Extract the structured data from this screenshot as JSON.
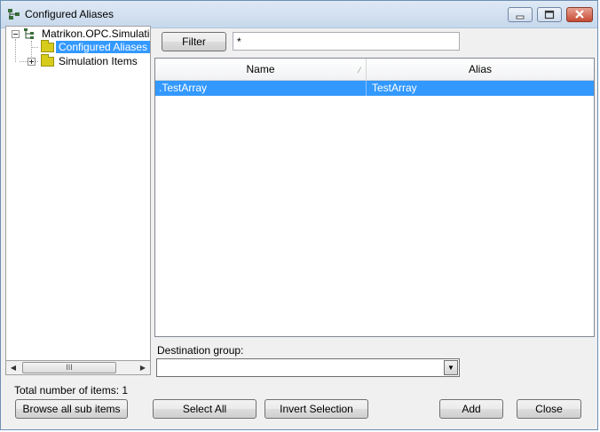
{
  "window": {
    "title": "Configured Aliases",
    "icon": "tree-network-icon",
    "controls": [
      "minimize",
      "maximize",
      "close"
    ]
  },
  "tree": {
    "root": {
      "label": "Matrikon.OPC.Simulatio",
      "expanded": true
    },
    "children": [
      {
        "label": "Configured Aliases",
        "selected": true
      },
      {
        "label": "Simulation Items",
        "expanded": false
      }
    ],
    "scroll_grip": "III"
  },
  "filter": {
    "button_label": "Filter",
    "value": "*"
  },
  "table": {
    "columns": [
      "Name",
      "Alias"
    ],
    "sort_indicator": "⁄",
    "rows": [
      {
        "name": ".TestArray",
        "alias": "TestArray",
        "selected": true
      }
    ]
  },
  "destination": {
    "label": "Destination group:",
    "value": ""
  },
  "status": {
    "total_text": "Total number of items: 1"
  },
  "buttons": {
    "browse": "Browse all sub items",
    "select_all": "Select All",
    "invert": "Invert Selection",
    "add": "Add",
    "close": "Close"
  },
  "colors": {
    "selection": "#3399ff",
    "folder": "#d7cc1a",
    "titlebar": "#dfe9f5"
  }
}
